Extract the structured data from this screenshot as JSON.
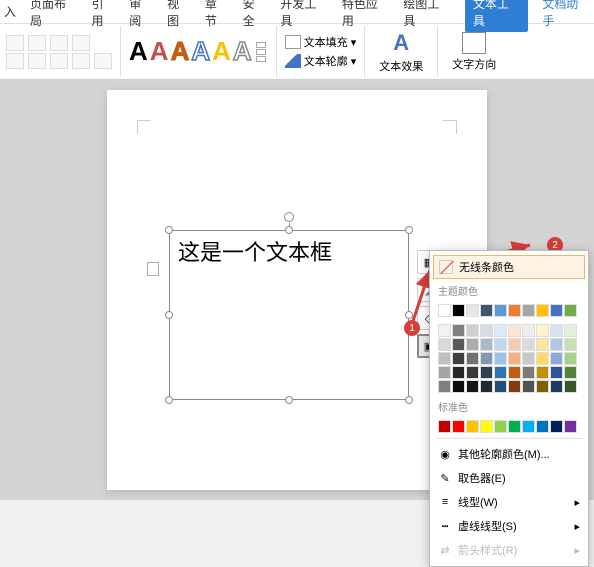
{
  "menu": [
    "入",
    "页面布局",
    "引用",
    "审阅",
    "视图",
    "章节",
    "安全",
    "开发工具",
    "特色应用",
    "绘图工具"
  ],
  "menu_active": "文本工具",
  "menu_doc_assist": "文档助手",
  "ribbon": {
    "fill_label": "文本填充",
    "outline_label": "文本轮廓",
    "effect_label": "文本效果",
    "textdir_label": "文字方向"
  },
  "textbox_content": "这是一个文本框",
  "popup": {
    "no_line": "无线条颜色",
    "theme_label": "主题颜色",
    "standard_label": "标准色",
    "more_colors": "其他轮廓颜色(M)...",
    "eyedropper": "取色器(E)",
    "line_style": "线型(W)",
    "dash_style": "虚线线型(S)",
    "arrow_style": "箭头样式(R)"
  },
  "theme_colors_row1": [
    "#ffffff",
    "#000000",
    "#e7e6e6",
    "#44546a",
    "#5b9bd5",
    "#ed7d31",
    "#a5a5a5",
    "#ffc000",
    "#4472c4",
    "#70ad47"
  ],
  "theme_shades": [
    [
      "#f2f2f2",
      "#7f7f7f",
      "#d0cece",
      "#d6dce4",
      "#deebf6",
      "#fbe5d5",
      "#ededed",
      "#fff2cc",
      "#d9e2f3",
      "#e2efd9"
    ],
    [
      "#d8d8d8",
      "#595959",
      "#aeabab",
      "#adb9ca",
      "#bdd7ee",
      "#f7cbac",
      "#dbdbdb",
      "#fee599",
      "#b4c6e7",
      "#c5e0b3"
    ],
    [
      "#bfbfbf",
      "#3f3f3f",
      "#757070",
      "#8496b0",
      "#9cc3e5",
      "#f4b183",
      "#c9c9c9",
      "#ffd965",
      "#8eaadb",
      "#a8d08d"
    ],
    [
      "#a5a5a5",
      "#262626",
      "#3a3838",
      "#323f4f",
      "#2e75b5",
      "#c55a11",
      "#7b7b7b",
      "#bf9000",
      "#2f5496",
      "#538135"
    ],
    [
      "#7f7f7f",
      "#0c0c0c",
      "#171616",
      "#222a35",
      "#1e4e79",
      "#833c0b",
      "#525252",
      "#7f6000",
      "#1f3864",
      "#375623"
    ]
  ],
  "standard_colors": [
    "#c00000",
    "#ff0000",
    "#ffc000",
    "#ffff00",
    "#92d050",
    "#00b050",
    "#00b0f0",
    "#0070c0",
    "#002060",
    "#7030a0"
  ],
  "annotations": {
    "b1": "1",
    "b2": "2"
  }
}
